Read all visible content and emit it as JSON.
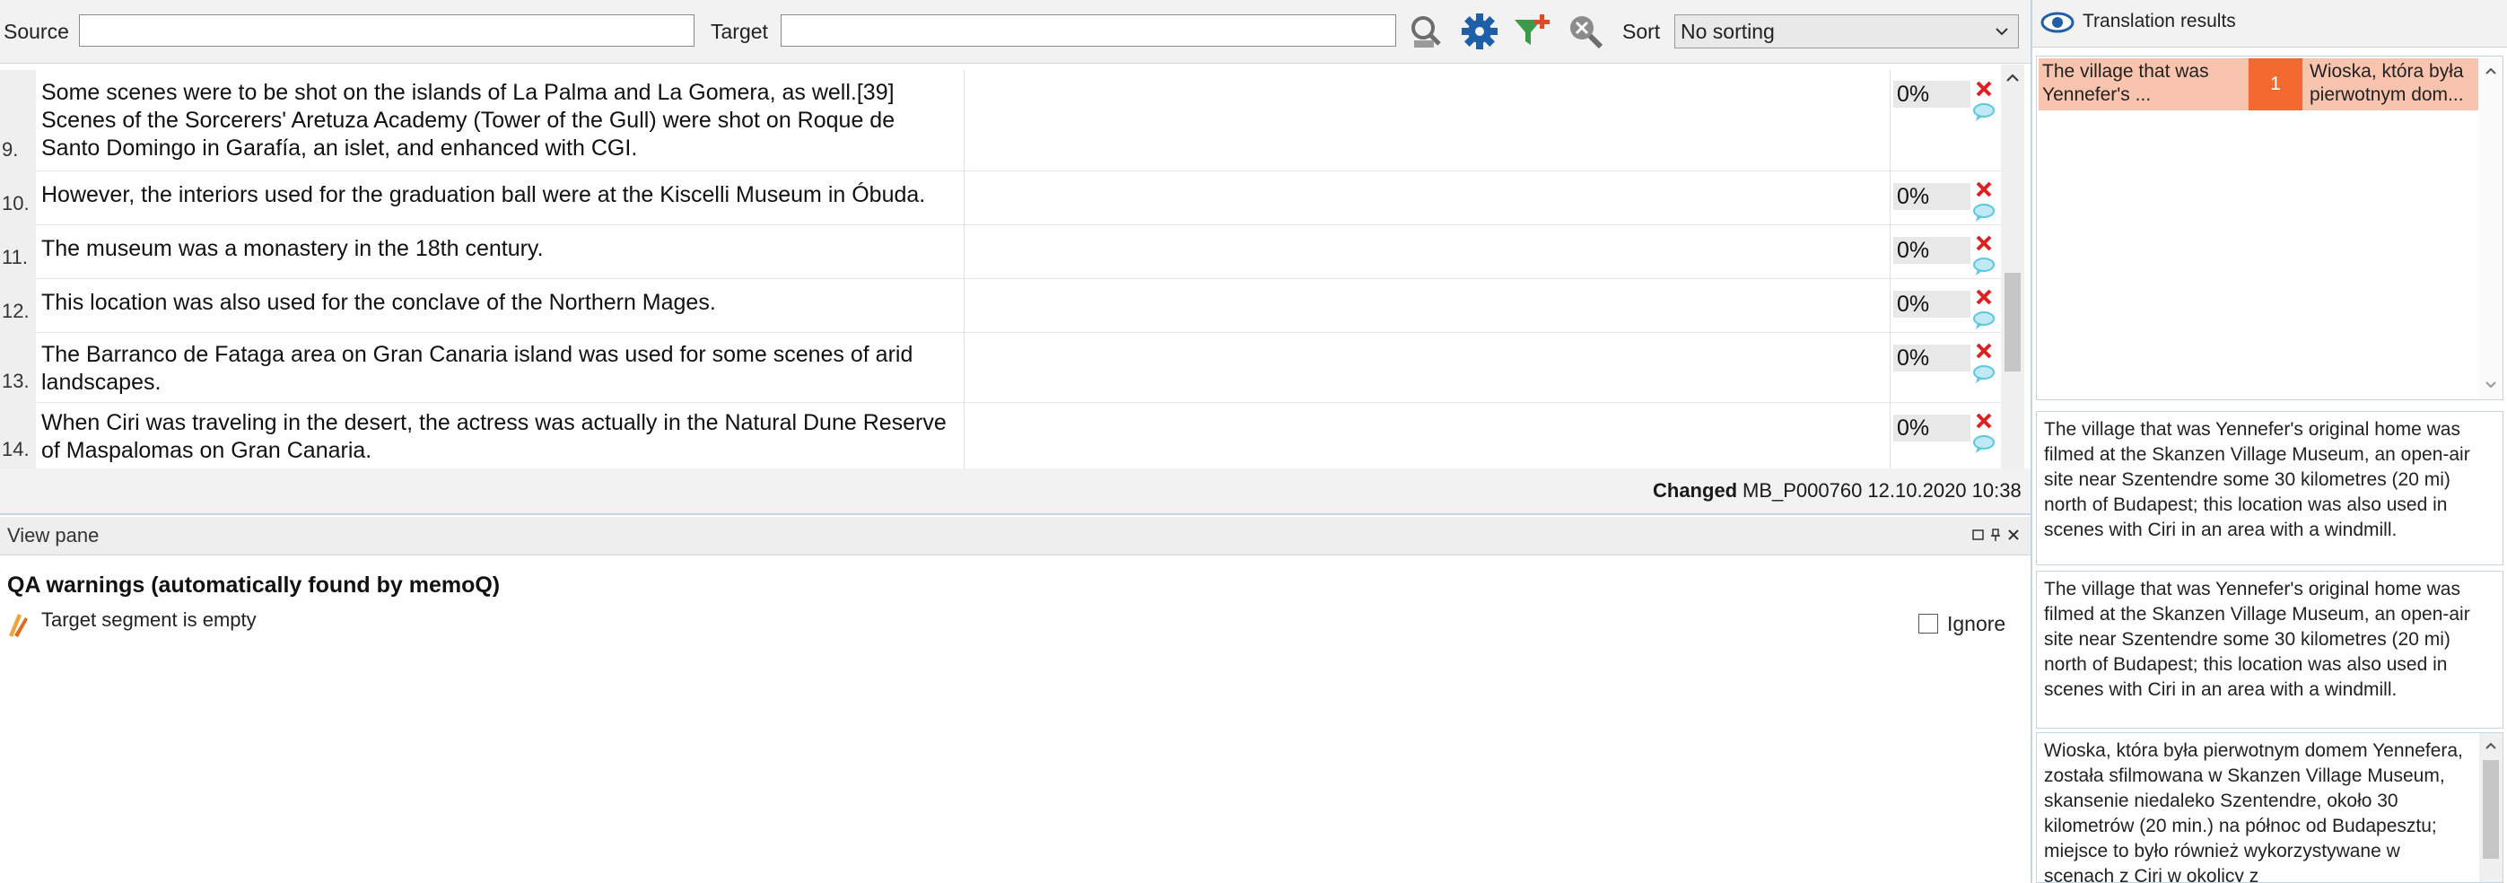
{
  "toolbar": {
    "source_label": "Source",
    "source_value": "",
    "target_label": "Target",
    "target_value": "",
    "sort_label": "Sort",
    "sort_value": "No sorting",
    "icons": [
      "filter-clear-icon",
      "settings-gear-icon",
      "add-filter-icon",
      "zoom-clear-icon"
    ]
  },
  "rows": [
    {
      "num": "9.",
      "source": "Some scenes were to be shot on the islands of La Palma and La Gomera, as well.[39] Scenes of the Sorcerers' Aretuza Academy (Tower of the Gull) were shot on Roque de Santo Domingo in Garafía, an islet, and enhanced with CGI.",
      "percent": "0%"
    },
    {
      "num": "10.",
      "source": "However, the interiors used for the graduation ball were at the Kiscelli Museum in Óbuda.",
      "percent": "0%"
    },
    {
      "num": "11.",
      "source": "The museum was a monastery in the 18th century.",
      "percent": "0%"
    },
    {
      "num": "12.",
      "source": "This location was also used for the conclave of the Northern Mages.",
      "percent": "0%"
    },
    {
      "num": "13.",
      "source": "The Barranco de Fataga area on Gran Canaria island was used for some scenes of arid landscapes.",
      "percent": "0%"
    },
    {
      "num": "14.",
      "source": "When Ciri was traveling in the desert, the actress was actually in the Natural Dune Reserve of Maspalomas on Gran Canaria.",
      "percent": "0%"
    }
  ],
  "status": {
    "changed": "Changed",
    "meta": "MB_P000760 12.10.2020 10:38"
  },
  "view_pane": {
    "title": "View pane",
    "qa_title": "QA warnings (automatically found by memoQ)",
    "qa_message": "Target segment is empty",
    "ignore_label": "Ignore"
  },
  "translation_results": {
    "title": "Translation results",
    "hit_source": "The village that was Yennefer's ...",
    "hit_number": "1",
    "hit_target": "Wioska, która była pierwotnym dom...",
    "detail_source": "The village that was Yennefer's original home was filmed at the Skanzen Village Museum, an open-air site near Szentendre some 30 kilometres (20 mi) north of Budapest; this location was also used in scenes with Ciri in an area with a windmill.",
    "detail_source_2": "The village that was Yennefer's original home was filmed at the Skanzen Village Museum, an open-air site near Szentendre some 30 kilometres (20 mi) north of Budapest; this location was also used in scenes with Ciri in an area with a windmill.",
    "detail_target": "Wioska, która była pierwotnym domem Yennefera, została sfilmowana w Skanzen Village Museum, skansenie niedaleko Szentendre, około 30 kilometrów (20 min.) na północ od Budapesztu; miejsce to było również wykorzystywane w scenach z Ciri w okolicy z"
  },
  "colors": {
    "accent_blue": "#1f5fa8",
    "hit_bg": "#f9c4ae",
    "hit_number_bg": "#f26a30",
    "delete_red": "#e02020",
    "comment_teal": "#5ac8e0"
  }
}
